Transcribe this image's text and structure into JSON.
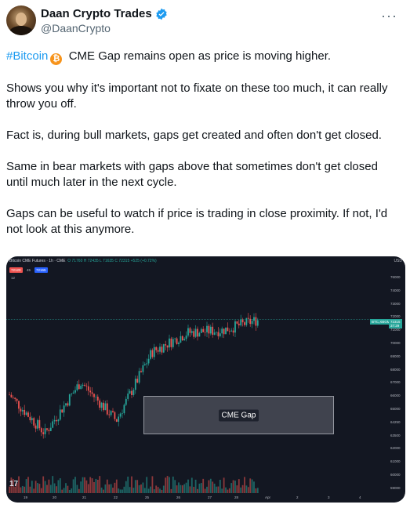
{
  "header": {
    "display_name": "Daan Crypto Trades",
    "handle": "@DaanCrypto",
    "more_icon": "more-dots-icon",
    "verified_icon": "verified-badge-icon"
  },
  "tweet": {
    "hashtag": "#Bitcoin",
    "bitcoin_emoji": "₿",
    "line1": "CME Gap remains open as price is moving higher.",
    "para2": "Shows you why it's important not to fixate on these too much, it can really throw you off.",
    "para3": "Fact is, during bull markets, gaps get created and often don't get closed.",
    "para4": "Same in bear markets with gaps above that sometimes don't get closed until much later in the next cycle.",
    "para5": "Gaps can be useful to watch if price is trading in close proximity. If not, I'd not look at this anymore."
  },
  "chart": {
    "title": "Bitcoin CME Futures · 1h · CME",
    "ohlc": "O 71760  H 72435  L 71635  C 72315  +525 (+0.72%)",
    "sell": "72120",
    "spread": "45",
    "buy": "72165",
    "volume_label": "12",
    "currency": "USD",
    "gap_label": "CME Gap",
    "symbol_tag": "BTC,XBGM",
    "last_price": "72315",
    "last_time": "37:29",
    "logo": "17",
    "colors": {
      "up": "#26a69a",
      "down": "#ef5350",
      "background": "#131722"
    },
    "y_ticks": [
      "76000",
      "74000",
      "73000",
      "72000",
      "71000",
      "70000",
      "69000",
      "68000",
      "67000",
      "66000",
      "65000",
      "64250",
      "63500",
      "62000",
      "61000",
      "60000",
      "59000"
    ],
    "x_ticks": [
      "19",
      "20",
      "21",
      "22",
      "25",
      "26",
      "27",
      "28",
      "Apr",
      "2",
      "3",
      "4"
    ]
  },
  "chart_data": {
    "type": "line",
    "title": "Bitcoin CME Futures · 1h · CME",
    "xlabel": "",
    "ylabel": "",
    "ylim": [
      59000,
      76000
    ],
    "x": [
      "19",
      "20",
      "21",
      "22",
      "25",
      "26",
      "27",
      "28"
    ],
    "series": [
      {
        "values": [
          66500,
          63500,
          67500,
          64500,
          69800,
          71300,
          71500,
          72315
        ]
      }
    ]
  }
}
